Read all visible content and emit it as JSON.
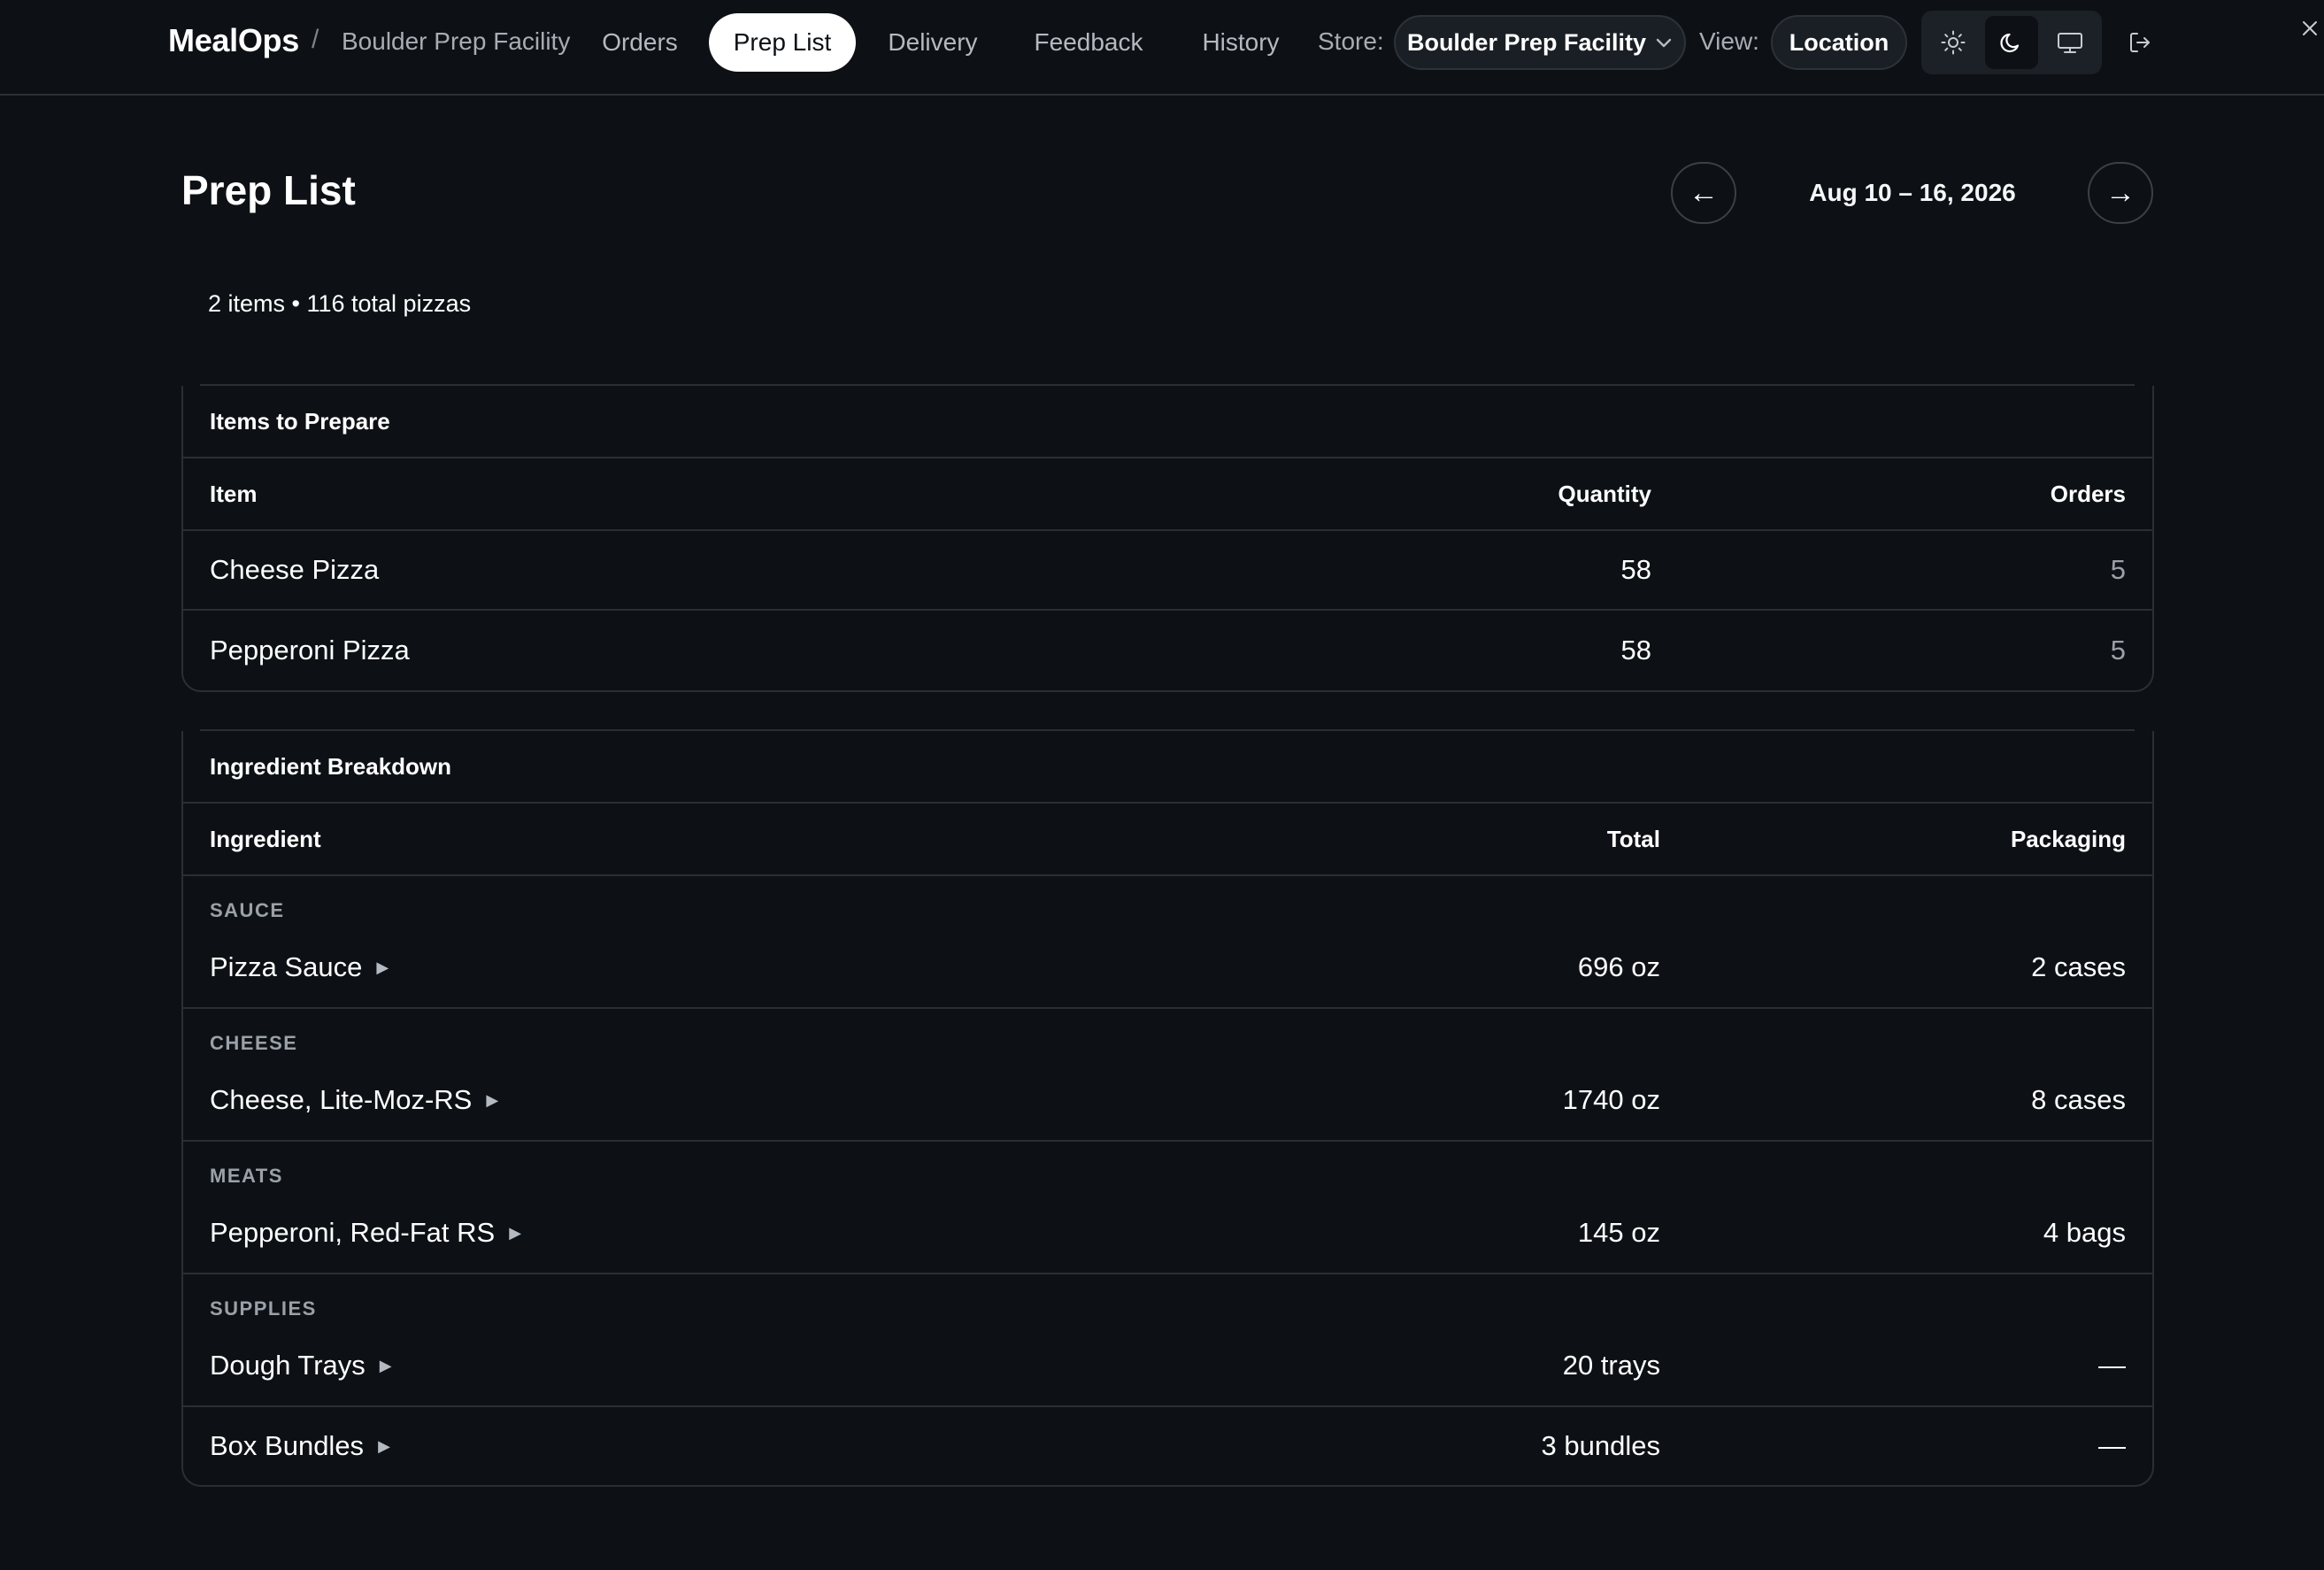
{
  "app": {
    "brand": "MealOps",
    "separator": "/",
    "breadcrumb": "Boulder Prep Facility"
  },
  "nav": {
    "orders": "Orders",
    "prep_list": "Prep List",
    "delivery": "Delivery",
    "feedback": "Feedback",
    "history": "History"
  },
  "store": {
    "label": "Store:",
    "value": "Boulder Prep Facility"
  },
  "view": {
    "label": "View:",
    "value": "Location"
  },
  "theme": {
    "options": [
      "sun-icon",
      "moon-icon",
      "monitor-icon"
    ],
    "active": "moon-icon"
  },
  "page": {
    "title": "Prep List",
    "prev_arrow": "←",
    "next_arrow": "→",
    "date_range": "Aug 10 – 16, 2026",
    "summary": "2 items • 116 total pizzas"
  },
  "items_card": {
    "title": "Items to Prepare",
    "columns": {
      "item": "Item",
      "quantity": "Quantity",
      "orders": "Orders"
    },
    "rows": [
      {
        "name": "Cheese Pizza",
        "quantity": "58",
        "orders": "5"
      },
      {
        "name": "Pepperoni Pizza",
        "quantity": "58",
        "orders": "5"
      }
    ]
  },
  "ingredients_card": {
    "title": "Ingredient Breakdown",
    "columns": {
      "ingredient": "Ingredient",
      "total": "Total",
      "packaging": "Packaging"
    },
    "groups": [
      {
        "category": "SAUCE",
        "items": [
          {
            "name": "Pizza Sauce",
            "total": "696 oz",
            "packaging": "2 cases"
          }
        ]
      },
      {
        "category": "CHEESE",
        "items": [
          {
            "name": "Cheese, Lite-Moz-RS",
            "total": "1740 oz",
            "packaging": "8 cases"
          }
        ]
      },
      {
        "category": "MEATS",
        "items": [
          {
            "name": "Pepperoni, Red-Fat RS",
            "total": "145 oz",
            "packaging": "4 bags"
          }
        ]
      },
      {
        "category": "SUPPLIES",
        "items": [
          {
            "name": "Dough Trays",
            "total": "20 trays",
            "packaging": "—"
          },
          {
            "name": "Box Bundles",
            "total": "3 bundles",
            "packaging": "—"
          }
        ]
      }
    ],
    "expand_glyph": "▶"
  },
  "colors": {
    "background": "#0d1115",
    "border": "#2a2f35",
    "muted": "#9aa1a8",
    "active_pill": "#ffffff"
  }
}
